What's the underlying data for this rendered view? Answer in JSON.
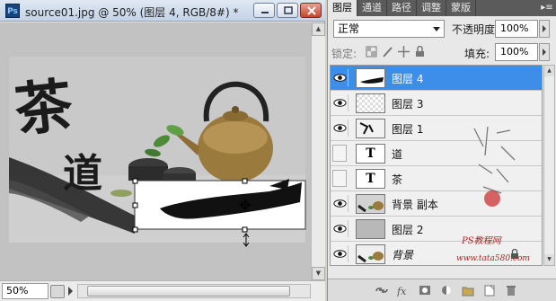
{
  "document": {
    "title": "source01.jpg @ 50% (图层 4, RGB/8#) *",
    "zoom": "50%",
    "canvas_text_main": "茶",
    "canvas_text_sub": "道"
  },
  "panel": {
    "tabs": [
      {
        "label": "图层",
        "active": true
      },
      {
        "label": "通道",
        "active": false
      },
      {
        "label": "路径",
        "active": false
      },
      {
        "label": "调整",
        "active": false
      },
      {
        "label": "蒙版",
        "active": false
      }
    ],
    "blend_mode": "正常",
    "opacity_label": "不透明度:",
    "opacity_value": "100%",
    "lock_label": "锁定:",
    "fill_label": "填充:",
    "fill_value": "100%",
    "layers": [
      {
        "name": "图层 4",
        "visible": true,
        "selected": true,
        "thumb": "brush"
      },
      {
        "name": "图层 3",
        "visible": true,
        "selected": false,
        "thumb": "transparent"
      },
      {
        "name": "图层 1",
        "visible": true,
        "selected": false,
        "thumb": "calligraphy"
      },
      {
        "name": "道",
        "visible": false,
        "selected": false,
        "thumb": "text"
      },
      {
        "name": "茶",
        "visible": false,
        "selected": false,
        "thumb": "text"
      },
      {
        "name": "背景 副本",
        "visible": true,
        "selected": false,
        "thumb": "photo"
      },
      {
        "name": "图层 2",
        "visible": true,
        "selected": false,
        "thumb": "gray"
      },
      {
        "name": "背景",
        "visible": true,
        "selected": false,
        "thumb": "photo",
        "locked": true
      }
    ],
    "thumb_text": "T",
    "watermark_url": "www.tata580.com",
    "watermark_label": "PS教程网"
  },
  "colors": {
    "selection": "#3d8ee8",
    "panel_bg": "#e8e8e8",
    "tab_bar": "#5b5b5b"
  }
}
